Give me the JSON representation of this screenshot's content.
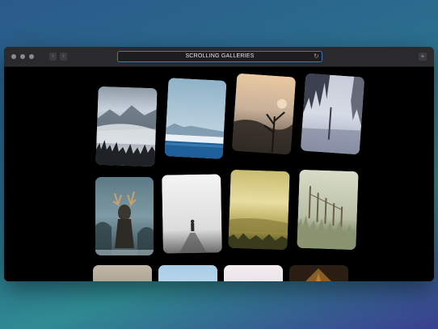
{
  "window": {
    "title": "SCROLLING GALLERIES",
    "url_placeholder": "SCROLLING GALLERIES"
  },
  "icons": {
    "back": "chevron-left-icon",
    "forward": "chevron-right-icon",
    "reload": "reload-icon",
    "new_tab": "plus-icon"
  },
  "gallery": {
    "images": [
      {
        "subject": "Misty mountains with pine forest",
        "colors": [
          "#c9d3dc",
          "#7f8a96",
          "#1e2226"
        ]
      },
      {
        "subject": "Frozen lake under blue sky",
        "colors": [
          "#b9cfdc",
          "#8fb2c8",
          "#1e5f9a"
        ]
      },
      {
        "subject": "Foggy sunrise with tree silhouette",
        "colors": [
          "#e9c9a0",
          "#8a7a6a",
          "#2a2620"
        ]
      },
      {
        "subject": "Misty forest lake",
        "colors": [
          "#d6dce6",
          "#9aa0b4",
          "#2e3040"
        ]
      },
      {
        "subject": "Stag with antlers in frosted forest",
        "colors": [
          "#7e9aa4",
          "#4c6670",
          "#1e2a2c"
        ]
      },
      {
        "subject": "Lone figure walking in fog",
        "colors": [
          "#f2f2f2",
          "#d8d8d8",
          "#4a4a4a"
        ]
      },
      {
        "subject": "Golden misty field",
        "colors": [
          "#e8dda0",
          "#a89a48",
          "#3a3a1c"
        ]
      },
      {
        "subject": "Frosted grass and fence",
        "colors": [
          "#d8dcc8",
          "#8a9470",
          "#4e5a38"
        ]
      },
      {
        "subject": "Dim cloudy sky",
        "colors": [
          "#c2b8a8",
          "#8a8070",
          "#3a342c"
        ]
      },
      {
        "subject": "Pale blue sky",
        "colors": [
          "#cfe4f4",
          "#a8cde6",
          "#6aa0c8"
        ]
      },
      {
        "subject": "Soft pink haze",
        "colors": [
          "#f2ecef",
          "#e0d4da",
          "#b8aab0"
        ]
      },
      {
        "subject": "Dark amber forest",
        "colors": [
          "#3a2a18",
          "#6a4420",
          "#b07830"
        ]
      }
    ]
  }
}
